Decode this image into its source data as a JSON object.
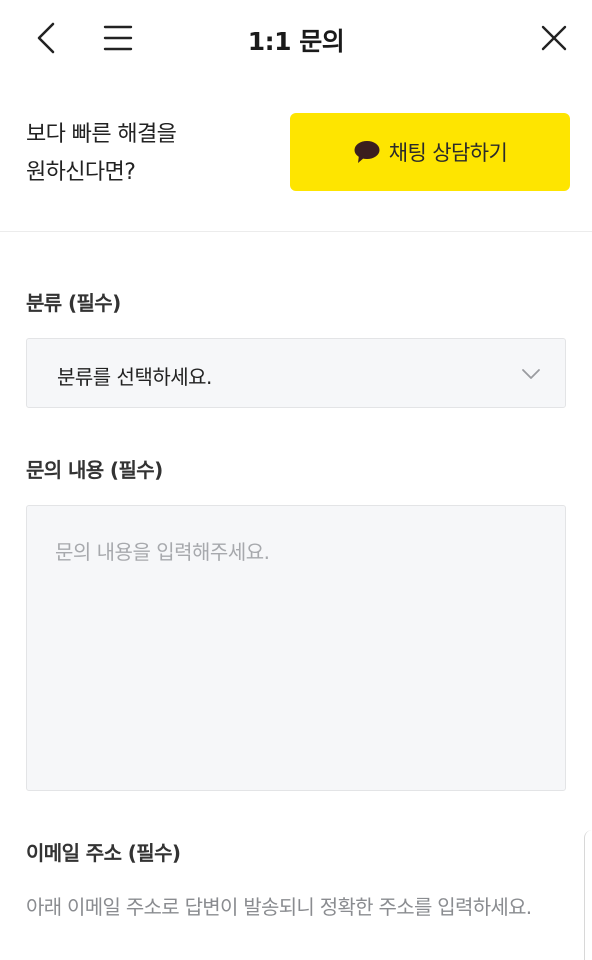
{
  "header": {
    "title": "1:1 문의",
    "back_icon": "chevron-left-icon",
    "menu_icon": "hamburger-menu-icon",
    "close_icon": "close-icon"
  },
  "promo": {
    "line1": "보다 빠른 해결을",
    "line2": "원하신다면?",
    "chat_button_label": "채팅 상담하기",
    "chat_icon": "speech-bubble-icon",
    "accent_color": "#fee500"
  },
  "form": {
    "category": {
      "label": "분류 (필수)",
      "selected_value": "분류를 선택하세요."
    },
    "content": {
      "label": "문의 내용 (필수)",
      "placeholder": "문의 내용을 입력해주세요.",
      "value": ""
    },
    "email": {
      "label": "이메일 주소 (필수)",
      "helper": "아래 이메일 주소로 답변이 발송되니 정확한 주소를 입력하세요."
    }
  }
}
